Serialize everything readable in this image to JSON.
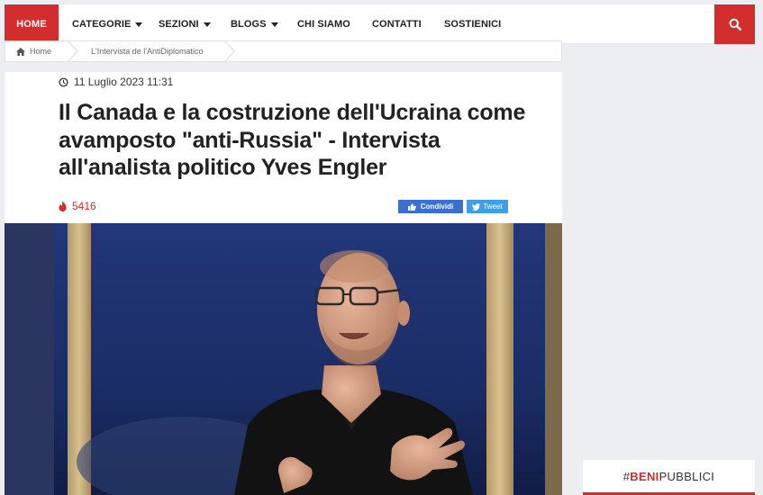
{
  "nav": {
    "home": "HOME",
    "items": [
      {
        "label": "CATEGORIE",
        "dropdown": true
      },
      {
        "label": "SEZIONI",
        "dropdown": true
      },
      {
        "label": "BLOGS",
        "dropdown": true
      },
      {
        "label": "CHI SIAMO",
        "dropdown": false
      },
      {
        "label": "CONTATTI",
        "dropdown": false
      },
      {
        "label": "SOSTIENICI",
        "dropdown": false
      }
    ],
    "search_icon": "search-icon"
  },
  "breadcrumb": {
    "home": "Home",
    "current": "L'Intervista de l'AntiDiplomatico"
  },
  "article": {
    "date": "11 Luglio 2023 11:31",
    "title": "Il Canada e la costruzione dell'Ucraina come avamposto \"anti-Russia\" - Intervista all'analista politico Yves Engler",
    "views": "5416",
    "share_facebook": "Condividi",
    "share_twitter": "Tweet"
  },
  "sidebar": {
    "widget_prefix": "#",
    "widget_red": "BENI",
    "widget_rest": "PUBBLICI"
  },
  "colors": {
    "accent": "#d42d2d",
    "facebook": "#3b6fd1",
    "twitter": "#3f9fe6"
  }
}
